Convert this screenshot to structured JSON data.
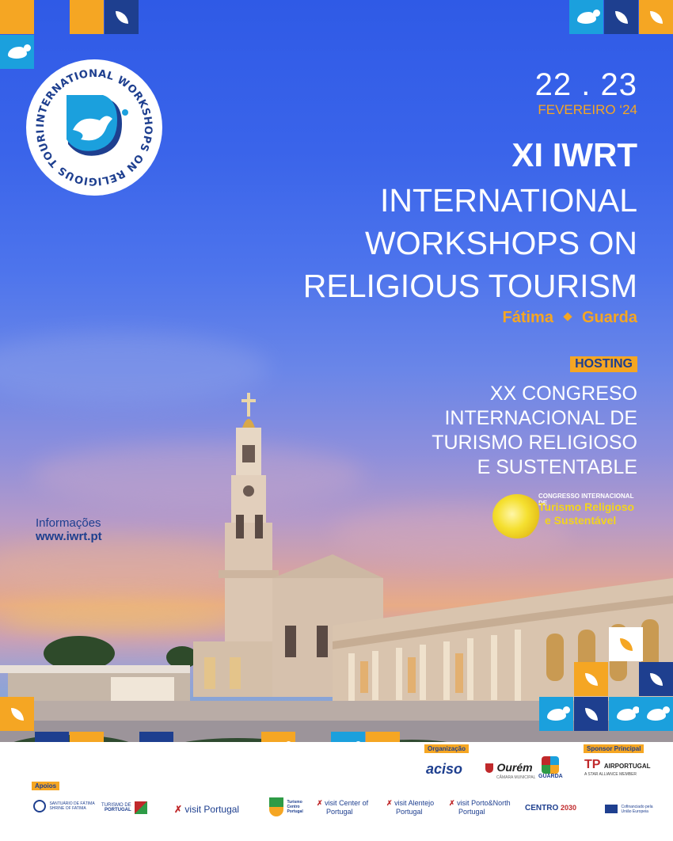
{
  "logo": {
    "ring_text": "INTERNATIONAL WORKSHOPS ON RELIGIOUS TOURISM"
  },
  "event": {
    "date": "22 . 23",
    "month": "FEVEREIRO ‘24",
    "edition": "XI IWRT",
    "title_lines": [
      "INTERNATIONAL",
      "WORKSHOPS ON",
      "RELIGIOUS TOURISM"
    ],
    "city_1": "Fátima",
    "city_2": "Guarda",
    "hosting_label": "HOSTING",
    "congreso_lines": [
      "XX CONGRESO",
      "INTERNACIONAL DE",
      "TURISMO RELIGIOSO",
      "E SUSTENTABLE"
    ]
  },
  "congress_logo": {
    "line_1": "CONGRESSO INTERNACIONAL DE",
    "line_2": "Turismo Religioso",
    "line_3": "e Sustentável"
  },
  "info": {
    "label": "Informações",
    "url": "www.iwrt.pt"
  },
  "footer": {
    "organizacao_label": "Organização",
    "sponsor_label": "Sponsor Principal",
    "apoios_label": "Apoios",
    "organizers": [
      "aciso",
      "Ourém",
      "GUARDA"
    ],
    "organizer_subtitles": {
      "ourem": "CÂMARA MUNICIPAL"
    },
    "sponsor": {
      "name": "AIRPORTUGAL",
      "mark": "TP",
      "tagline": "A STAR ALLIANCE MEMBER"
    },
    "supporters": [
      {
        "name": "SANTUÁRIO DE FÁTIMA",
        "sub": "SHRINE OF FATIMA"
      },
      {
        "name": "TURISMO DE",
        "sub": "PORTUGAL"
      },
      {
        "name": "visit Portugal",
        "sub": ""
      },
      {
        "name": "Turismo Centro Portugal",
        "sub": ""
      },
      {
        "name": "visit Center of",
        "sub": "Portugal"
      },
      {
        "name": "visit Alentejo",
        "sub": "Portugal"
      },
      {
        "name": "visit Porto&North",
        "sub": "Portugal"
      },
      {
        "name": "CENTRO",
        "sub": "2030"
      },
      {
        "name": "Cofinanciado pela",
        "sub": "União Europeia"
      }
    ]
  },
  "colors": {
    "orange": "#f5a623",
    "dark_blue": "#1e3f8f",
    "sky_blue": "#1ba0dd",
    "sky_top": "#2f5ae6"
  }
}
